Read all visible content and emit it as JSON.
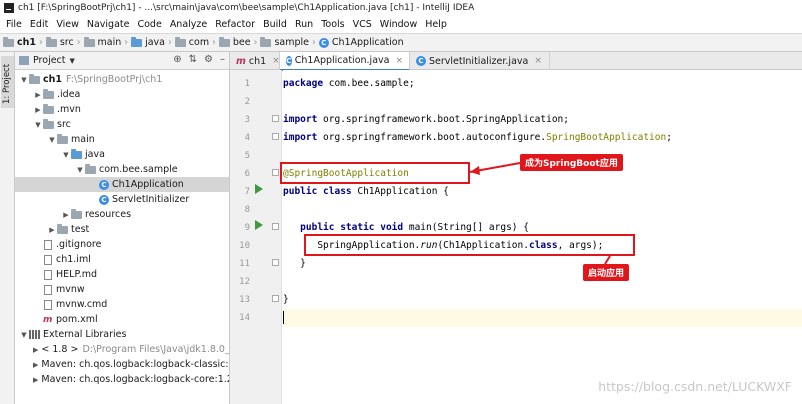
{
  "window": {
    "title": "ch1 [F:\\SpringBootPrj\\ch1] - ...\\src\\main\\java\\com\\bee\\sample\\Ch1Application.java [ch1] - IntelliJ IDEA"
  },
  "menu": [
    "File",
    "Edit",
    "View",
    "Navigate",
    "Code",
    "Analyze",
    "Refactor",
    "Build",
    "Run",
    "Tools",
    "VCS",
    "Window",
    "Help"
  ],
  "breadcrumb": [
    "ch1",
    "src",
    "main",
    "java",
    "com",
    "bee",
    "sample",
    "Ch1Application"
  ],
  "toolwindow": {
    "strip_label": "1: Project",
    "header_label": "Project"
  },
  "tree": [
    {
      "label": "ch1",
      "extra": "F:\\SpringBootPrj\\ch1"
    },
    {
      "label": ".idea"
    },
    {
      "label": ".mvn"
    },
    {
      "label": "src"
    },
    {
      "label": "main"
    },
    {
      "label": "java"
    },
    {
      "label": "com.bee.sample"
    },
    {
      "label": "Ch1Application"
    },
    {
      "label": "ServletInitializer"
    },
    {
      "label": "resources"
    },
    {
      "label": "test"
    },
    {
      "label": ".gitignore"
    },
    {
      "label": "ch1.iml"
    },
    {
      "label": "HELP.md"
    },
    {
      "label": "mvnw"
    },
    {
      "label": "mvnw.cmd"
    },
    {
      "label": "pom.xml"
    },
    {
      "label": "External Libraries"
    },
    {
      "label": "< 1.8 >",
      "extra": "D:\\Program Files\\Java\\jdk1.8.0_16"
    },
    {
      "label": "Maven: ch.qos.logback:logback-classic:1."
    },
    {
      "label": "Maven: ch.qos.logback:logback-core:1.2."
    }
  ],
  "tabs": [
    "ch1",
    "Ch1Application.java",
    "ServletInitializer.java"
  ],
  "code": {
    "line_numbers": [
      "1",
      "2",
      "3",
      "4",
      "5",
      "6",
      "7",
      "8",
      "9",
      "10",
      "11",
      "12",
      "13",
      "14"
    ],
    "l1_kw": "package",
    "l1_rest": " com.bee.sample;",
    "l3_kw": "import",
    "l3_rest": " org.springframework.boot.SpringApplication;",
    "l4_kw": "import",
    "l4_rest": " org.springframework.boot.autoconfigure.",
    "l4_ann": "SpringBootApplication",
    "l4_end": ";",
    "l6_ann": "@SpringBootApplication",
    "l7_kw": "public class",
    "l7_rest": " Ch1Application {",
    "l9_kw": "public static void",
    "l9_rest": " main(String[] args) {",
    "l10_a": "SpringApplication.",
    "l10_it": "run",
    "l10_b": "(Ch1Application.",
    "l10_kw": "class",
    "l10_c": ", args);",
    "l11": "}",
    "l13": "}"
  },
  "annotations": {
    "callout1": "成为SpringBoot应用",
    "callout2": "启动应用"
  },
  "watermark": "https://blog.csdn.net/LUCKWXF"
}
